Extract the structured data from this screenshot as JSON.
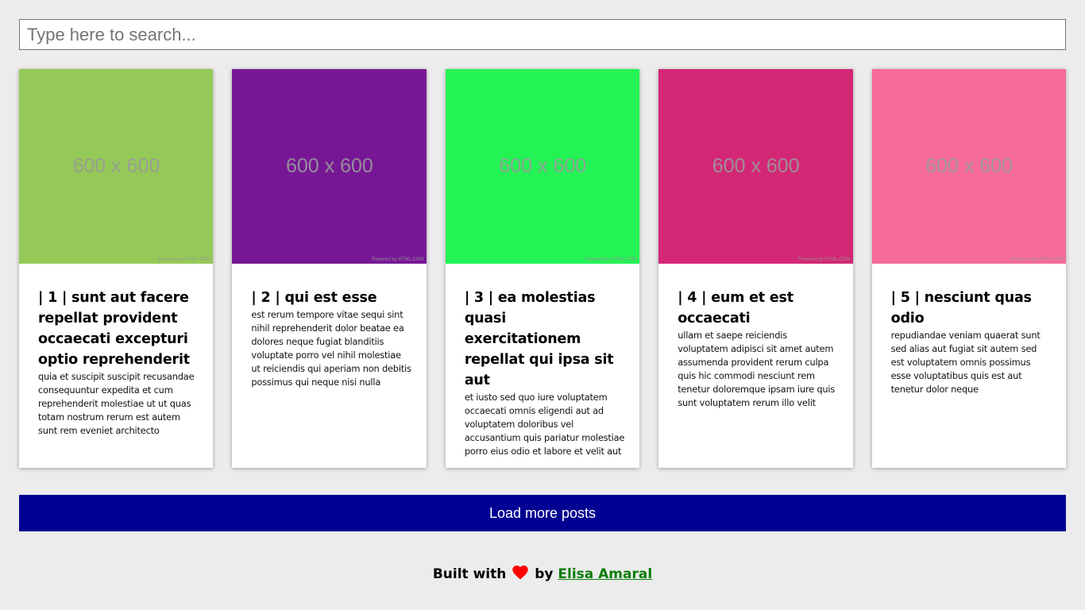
{
  "search": {
    "placeholder": "Type here to search...",
    "value": ""
  },
  "posts": [
    {
      "image_color": "#95c957",
      "image_label": "600 x 600",
      "image_credit": "Powered by HTML.COM",
      "title": "| 1 | sunt aut facere repellat provident occaecati excepturi optio reprehenderit",
      "body": "quia et suscipit suscipit recusandae consequuntur expedita et cum reprehenderit molestiae ut ut quas totam nostrum rerum est autem sunt rem eveniet architecto"
    },
    {
      "image_color": "#771796",
      "image_label": "600 x 600",
      "image_credit": "Powered by HTML.COM",
      "title": "| 2 | qui est esse",
      "body": "est rerum tempore vitae sequi sint nihil reprehenderit dolor beatae ea dolores neque fugiat blanditiis voluptate porro vel nihil molestiae ut reiciendis qui aperiam non debitis possimus qui neque nisi nulla"
    },
    {
      "image_color": "#24f355",
      "image_label": "600 x 600",
      "image_credit": "Powered by HTML.COM",
      "title": "| 3 | ea molestias quasi exercitationem repellat qui ipsa sit aut",
      "body": "et iusto sed quo iure voluptatem occaecati omnis eligendi aut ad voluptatem doloribus vel accusantium quis pariatur molestiae porro eius odio et labore et velit aut"
    },
    {
      "image_color": "#d32776",
      "image_label": "600 x 600",
      "image_credit": "Powered by HTML.COM",
      "title": "| 4 | eum et est occaecati",
      "body": "ullam et saepe reiciendis voluptatem adipisci sit amet autem assumenda provident rerum culpa quis hic commodi nesciunt rem tenetur doloremque ipsam iure quis sunt voluptatem rerum illo velit"
    },
    {
      "image_color": "#f66b97",
      "image_label": "600 x 600",
      "image_credit": "Powered by HTML.COM",
      "title": "| 5 | nesciunt quas odio",
      "body": "repudiandae veniam quaerat sunt sed alias aut fugiat sit autem sed est voluptatem omnis possimus esse voluptatibus quis est aut tenetur dolor neque"
    }
  ],
  "load_more": {
    "label": "Load more posts"
  },
  "footer": {
    "prefix": "Built with",
    "heart_icon": "heart-icon",
    "heart_color": "#ff0000",
    "by": "by",
    "author": "Elisa Amaral",
    "author_color": "#0a7d0a"
  },
  "colors": {
    "page_background": "#ececec",
    "button_background": "#000092"
  }
}
